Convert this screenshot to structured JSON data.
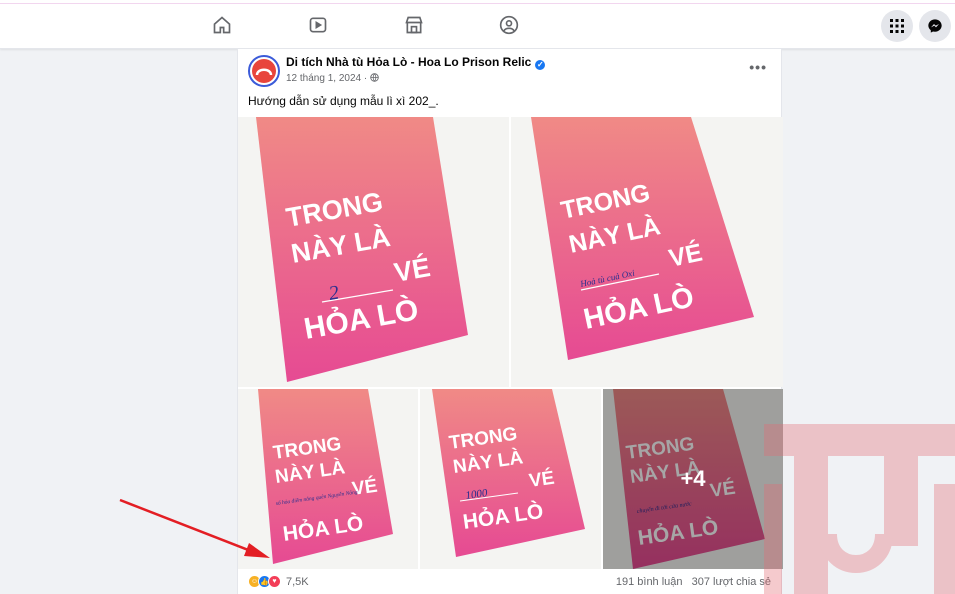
{
  "post": {
    "page_name": "Di tích Nhà tù Hỏa Lò - Hoa Lo Prison Relic",
    "date": "12 tháng 1, 2024 ·",
    "caption": "Hướng dẫn sử dụng mẫu lì xì 202_.",
    "more": "•••",
    "photos": [
      {
        "line1": "TRONG",
        "line2": "NÀY LÀ",
        "line3": "VÉ",
        "line4": "HỎA LÒ",
        "handwriting": "2"
      },
      {
        "line1": "TRONG",
        "line2": "NÀY LÀ",
        "line3": "VÉ",
        "line4": "HỎA LÒ",
        "handwriting": "Hoả tù cuả Oxi"
      },
      {
        "line1": "TRONG",
        "line2": "NÀY LÀ",
        "line3": "VÉ",
        "line4": "HỎA LÒ",
        "handwriting": "số hỏa điểm nắng quên Nguyễn Nông"
      },
      {
        "line1": "TRONG",
        "line2": "NÀY LÀ",
        "line3": "VÉ",
        "line4": "HỎA LÒ",
        "handwriting": "1000"
      },
      {
        "line1": "TRONG",
        "line2": "NÀY LÀ",
        "line3": "VÉ",
        "line4": "HỎA LÒ",
        "handwriting": "chuyến đi tới cửa nước"
      }
    ],
    "more_photos": "+4",
    "reaction_count": "7,5K",
    "comments": "191 bình luận",
    "shares": "307 lượt chia sẻ"
  },
  "colors": {
    "envelope_top": "#f08a86",
    "envelope_bottom": "#e64a93",
    "brand_blue": "#1877f2",
    "watermark": "#e46a73"
  }
}
